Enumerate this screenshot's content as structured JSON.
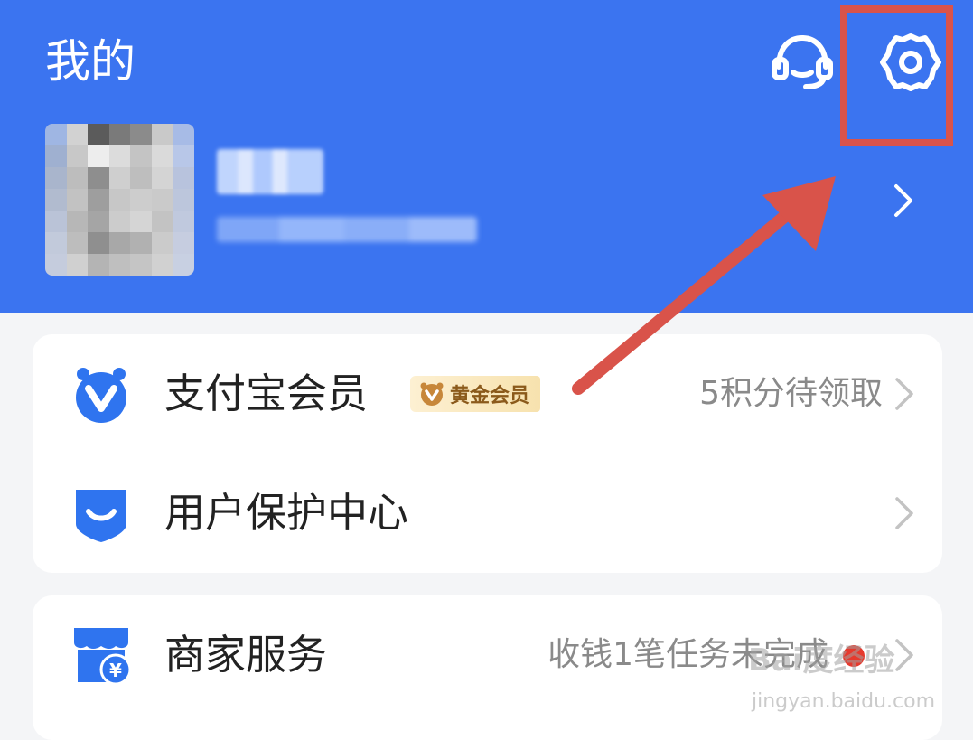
{
  "header": {
    "title": "我的",
    "support_icon": "headset-icon",
    "settings_icon": "gear-icon",
    "profile_chevron_icon": "chevron-right-icon"
  },
  "colors": {
    "header_bg": "#3b74f0",
    "highlight": "#d9534a",
    "card_bg": "#ffffff",
    "page_bg": "#f4f5f7"
  },
  "sections": [
    {
      "rows": [
        {
          "label": "支付宝会员",
          "badge": "黄金会员",
          "value": "5积分待领取",
          "icon": "member-v-icon"
        },
        {
          "label": "用户保护中心",
          "value": "",
          "icon": "shield-smile-icon"
        }
      ]
    },
    {
      "rows": [
        {
          "label": "商家服务",
          "value": "收钱1笔任务未完成",
          "icon": "store-yuan-icon",
          "has_red_dot": true
        }
      ]
    }
  ],
  "watermark": {
    "top": "Bai度经验",
    "bottom": "jingyan.baidu.com"
  }
}
